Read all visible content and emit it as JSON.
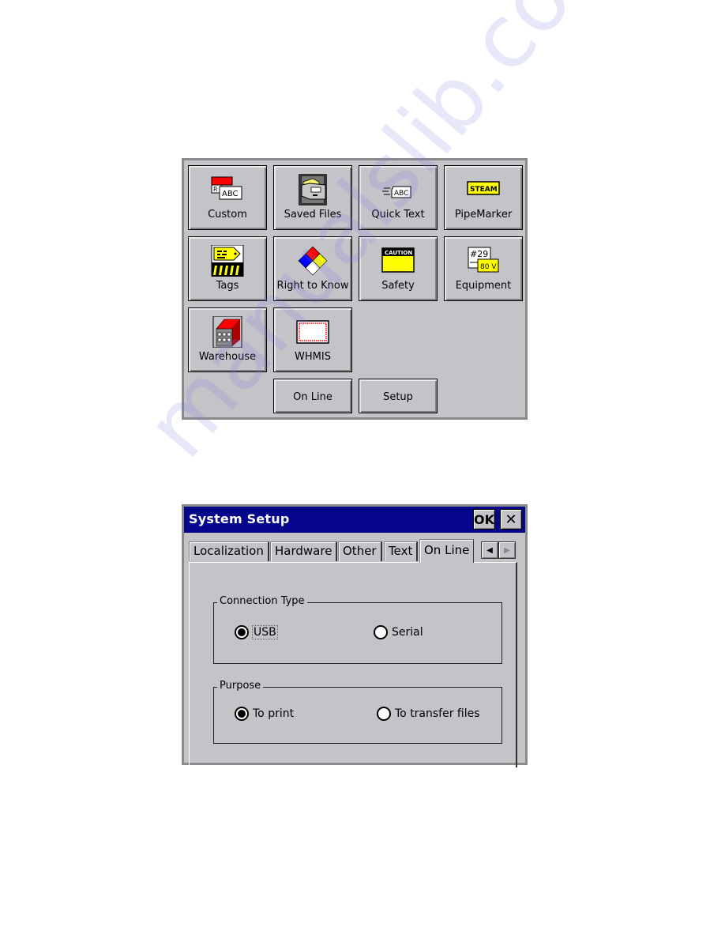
{
  "launcher": {
    "tiles": [
      {
        "label": "Custom",
        "icon": "custom-label-icon"
      },
      {
        "label": "Saved Files",
        "icon": "file-cabinet-icon"
      },
      {
        "label": "Quick Text",
        "icon": "quick-text-icon"
      },
      {
        "label": "PipeMarker",
        "icon": "steam-pipe-marker-icon"
      },
      {
        "label": "Tags",
        "icon": "tag-icon"
      },
      {
        "label": "Right to Know",
        "icon": "nfpa-diamond-icon"
      },
      {
        "label": "Safety",
        "icon": "caution-sign-icon"
      },
      {
        "label": "Equipment",
        "icon": "equipment-label-icon"
      },
      {
        "label": "Warehouse",
        "icon": "warehouse-icon"
      },
      {
        "label": "WHMIS",
        "icon": "whmis-border-icon"
      }
    ],
    "online_label": "On Line",
    "setup_label": "Setup",
    "icon_text": {
      "custom_r": "R",
      "custom_abc": "ABC",
      "quick_abc": "ABC",
      "steam": "STEAM",
      "caution": "CAUTION",
      "equip_num": "#29",
      "equip_volt": "80 V"
    }
  },
  "dialog": {
    "title": "System Setup",
    "ok_label": "OK",
    "close_label": "✕",
    "tabs": [
      {
        "label": "Localization",
        "active": false
      },
      {
        "label": "Hardware",
        "active": false
      },
      {
        "label": "Other",
        "active": false
      },
      {
        "label": "Text",
        "active": false
      },
      {
        "label": "On Line",
        "active": true
      }
    ],
    "scroll_left": "◀",
    "scroll_right": "▶",
    "connection_type": {
      "label": "Connection Type",
      "options": [
        {
          "label": "USB",
          "selected": true
        },
        {
          "label": "Serial",
          "selected": false
        }
      ]
    },
    "purpose": {
      "label": "Purpose",
      "options": [
        {
          "label": "To print",
          "selected": true
        },
        {
          "label": "To transfer files",
          "selected": false
        }
      ]
    }
  },
  "watermark": "manualslib.com",
  "colors": {
    "titlebar": "#06068c",
    "face": "#c4c3c8",
    "frame": "#8a8a8a",
    "label_yellow": "#ffff00",
    "accent_red": "#ff0000"
  }
}
